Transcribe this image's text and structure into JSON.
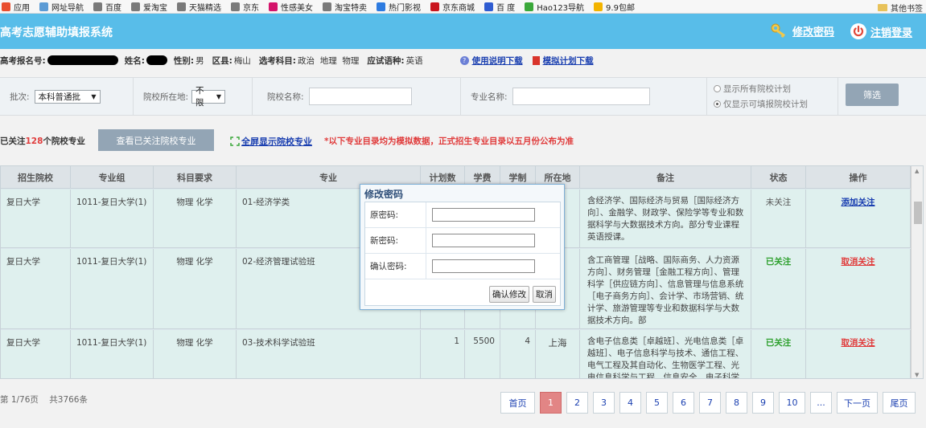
{
  "bookmarks": {
    "items": [
      {
        "label": "应用",
        "color": "#e94e2f"
      },
      {
        "label": "网址导航",
        "color": "#5b9bd5"
      },
      {
        "label": "百度",
        "color": "#7a7a7a"
      },
      {
        "label": "爱淘宝",
        "color": "#7a7a7a"
      },
      {
        "label": "天猫精选",
        "color": "#7a7a7a"
      },
      {
        "label": "京东",
        "color": "#7a7a7a"
      },
      {
        "label": "性感美女",
        "color": "#d4146b"
      },
      {
        "label": "淘宝特卖",
        "color": "#7a7a7a"
      },
      {
        "label": "热门影视",
        "color": "#2d7be0"
      },
      {
        "label": "京东商城",
        "color": "#c9151e"
      },
      {
        "label": "百 度",
        "color": "#2f5cd1"
      },
      {
        "label": "Hao123导航",
        "color": "#3aa83a"
      },
      {
        "label": "9.9包邮",
        "color": "#f3b400"
      }
    ],
    "other": "其他书签"
  },
  "header": {
    "title": "高考志愿辅助填报系统",
    "change_password": "修改密码",
    "logout": "注销登录"
  },
  "info": {
    "exam_no_label": "高考报名号:",
    "name_label": "姓名:",
    "gender_label": "性别:",
    "gender": "男",
    "district_label": "区县:",
    "district": "梅山",
    "subjects_label": "选考科目:",
    "subjects": "政治  地理  物理",
    "language_label": "应试语种:",
    "language": "英语",
    "manual_link": "使用说明下载",
    "plan_link": "模拟计划下载"
  },
  "filters": {
    "batch_label": "批次:",
    "batch_value": "本科普通批",
    "location_label": "院校所在地:",
    "location_value": "不限",
    "school_label": "院校名称:",
    "major_label": "专业名称:",
    "radio_all": "显示所有院校计划",
    "radio_fillable": "仅显示可填报院校计划",
    "filter_button": "筛选"
  },
  "follow": {
    "prefix": "已关注",
    "count": "128",
    "suffix": "个院校专业",
    "view_button": "查看已关注院校专业",
    "fullscreen_link": "全屏显示院校专业",
    "notice": "*以下专业目录均为模拟数据，正式招生专业目录以五月份公布为准"
  },
  "table": {
    "headers": [
      "招生院校",
      "专业组",
      "科目要求",
      "专业",
      "计划数",
      "学费",
      "学制",
      "所在地",
      "备注",
      "状态",
      "操作"
    ],
    "rows": [
      {
        "school": "复日大学",
        "group": "1011-复日大学(1)",
        "subjects": "物理 化学",
        "major": "01-经济学类",
        "plan": "",
        "fee": "",
        "years": "",
        "location": "",
        "note": "含经济学、国际经济与贸易［国际经济方向］、金融学、财政学、保险学等专业和数据科学与大数据技术方向。部分专业课程英语授课。",
        "status": "未关注",
        "action": "添加关注"
      },
      {
        "school": "复日大学",
        "group": "1011-复日大学(1)",
        "subjects": "物理 化学",
        "major": "02-经济管理试验班",
        "plan": "",
        "fee": "",
        "years": "",
        "location": "",
        "note": "含工商管理［战略、国际商务、人力资源方向］、财务管理［金融工程方向］、管理科学［供应链方向］、信息管理与信息系统［电子商务方向］、会计学、市场营销、统计学、旅游管理等专业和数据科学与大数据技术方向。部",
        "status": "已关注",
        "action": "取消关注"
      },
      {
        "school": "复日大学",
        "group": "1011-复日大学(1)",
        "subjects": "物理 化学",
        "major": "03-技术科学试验班",
        "plan": "1",
        "fee": "5500",
        "years": "4",
        "location": "上海",
        "note": "含电子信息类［卓越班］、光电信息类［卓越班］、电子信息科学与技术、通信工程、电气工程及其自动化、生物医学工程、光电信息科学与工程、信息安全、电子科学与技",
        "status": "已关注",
        "action": "取消关注"
      }
    ]
  },
  "footer": {
    "page_info": "第 1/76页",
    "total": "共3766条",
    "first": "首页",
    "pages": [
      "1",
      "2",
      "3",
      "4",
      "5",
      "6",
      "7",
      "8",
      "9",
      "10",
      "..."
    ],
    "next": "下一页",
    "last": "尾页"
  },
  "modal": {
    "title": "修改密码",
    "old_label": "原密码:",
    "new_label": "新密码:",
    "confirm_label": "确认密码:",
    "confirm_button": "确认修改",
    "cancel_button": "取消"
  },
  "colors": {
    "header_bg": "#58bde9",
    "row_bg": "#dff0ee",
    "followed": "#2ea02e",
    "warning": "#e03c3c",
    "link": "#1a3fb0"
  }
}
